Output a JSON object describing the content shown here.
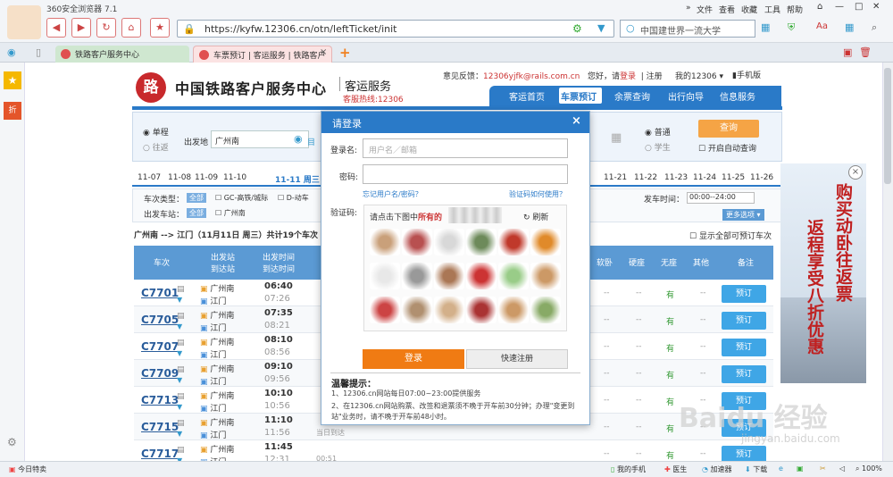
{
  "browser": {
    "title": "360安全浏览器 7.1",
    "url": "https://kyfw.12306.cn/otn/leftTicket/init",
    "search": "中国建世界一流大学",
    "menu": [
      "文件",
      "查看",
      "收藏",
      "工具",
      "帮助"
    ],
    "tabs": [
      "铁路客户服务中心",
      "车票预订 | 客运服务 | 铁路客户"
    ],
    "new_tab": "+"
  },
  "site": {
    "logo": "路",
    "title": "中国铁路客户服务中心",
    "subtitle": "客运服务",
    "hotline": "客服热线:12306",
    "feedback": "意见反馈：",
    "feedback_email": "12306yjfk@rails.com.cn",
    "greeting": "您好，请",
    "login_link": "登录",
    "register": "注册",
    "my": "我的12306 ▾",
    "mobile": "手机版",
    "nav": [
      "客运首页",
      "车票预订",
      "余票查询",
      "出行向导",
      "信息服务"
    ]
  },
  "query": {
    "one_way": "单程",
    "round_trip": "往返",
    "from_label": "出发地",
    "from_value": "广州南",
    "to_label": "目",
    "normal": "普通",
    "student": "学生",
    "query": "查询",
    "auto_query": "开启自动查询"
  },
  "dates": [
    "11-07",
    "11-08",
    "11-09",
    "11-10",
    "11-11 周三",
    "11-21",
    "11-22",
    "11-23",
    "11-24",
    "11-25",
    "11-26"
  ],
  "filter": {
    "type_label": "车次类型：",
    "all1": "全部",
    "gc": "GC-高铁/城际",
    "d": "D-动车",
    "station_label": "出发车站：",
    "all2": "全部",
    "gzn": "广州南",
    "depart_time_label": "发车时间：",
    "depart_time": "00:00--24:00",
    "more": "更多选项 ▾"
  },
  "summary": "广州南 --> 江门（11月11日  周三）共计19个车次",
  "show_all": "显示全部可预订车次",
  "table": {
    "headers": [
      "车次",
      "出发站\n到达站",
      "出发时间\n到达时间",
      "软卧",
      "硬座",
      "无座",
      "其他",
      "备注"
    ],
    "rows": [
      {
        "train": "C7701",
        "from": "广州南",
        "to": "江门",
        "dep": "06:40",
        "arr": "07:26",
        "c1": "有",
        "btn": "预订"
      },
      {
        "train": "C7705",
        "from": "广州南",
        "to": "江门",
        "dep": "07:35",
        "arr": "08:21",
        "c1": "有",
        "btn": "预订"
      },
      {
        "train": "C7707",
        "from": "广州南",
        "to": "江门",
        "dep": "08:10",
        "arr": "08:56",
        "c1": "有",
        "btn": "预订"
      },
      {
        "train": "C7709",
        "from": "广州南",
        "to": "江门",
        "dep": "09:10",
        "arr": "09:56",
        "c1": "有",
        "btn": "预订"
      },
      {
        "train": "C7713",
        "from": "广州南",
        "to": "江门",
        "dep": "10:10",
        "arr": "10:56",
        "c1": "有",
        "btn": "预订"
      },
      {
        "train": "C7715",
        "from": "广州南",
        "to": "江门",
        "dep": "11:10",
        "arr": "11:56",
        "c1": "有",
        "btn": "预订",
        "note": "当日到达"
      },
      {
        "train": "C7717",
        "from": "广州南",
        "to": "江门",
        "dep": "11:45",
        "arr": "12:31",
        "c1": "有",
        "btn": "预订",
        "note": "00:51"
      }
    ],
    "dash": "--"
  },
  "ad": {
    "text1": "购买动卧往返票",
    "text2": "返程享受八折优惠",
    "close": "×"
  },
  "modal": {
    "title": "请登录",
    "close": "×",
    "user_label": "登录名:",
    "user_ph": "用户名／邮箱",
    "pwd_label": "密码:",
    "forgot": "忘记用户名/密码？",
    "captcha_help": "验证码如何使用？",
    "captcha_label": "验证码:",
    "captcha_prompt": "请点击下图中",
    "captcha_bold": "所有的",
    "refresh": "刷新",
    "login": "登录",
    "quick_reg": "快速注册",
    "tips_title": "温馨提示：",
    "tip1": "1、12306.cn网站每日07:00~23:00提供服务",
    "tip2": "2、在12306.cn网站购票、改签和退票须不晚于开车前30分钟；办理\"变更到站\"业务时，请不晚于开车前48小时。"
  },
  "watermark": {
    "main": "Baidu 经验",
    "sub": "jingyan.baidu.com"
  },
  "status": {
    "left": "今日特卖",
    "items": [
      "我的手机",
      "医生",
      "加速器",
      "下载"
    ],
    "zoom": "100%"
  },
  "colors": {
    "brand": "#2a7ac8",
    "accent": "#f07b13",
    "red": "#c8292c"
  }
}
